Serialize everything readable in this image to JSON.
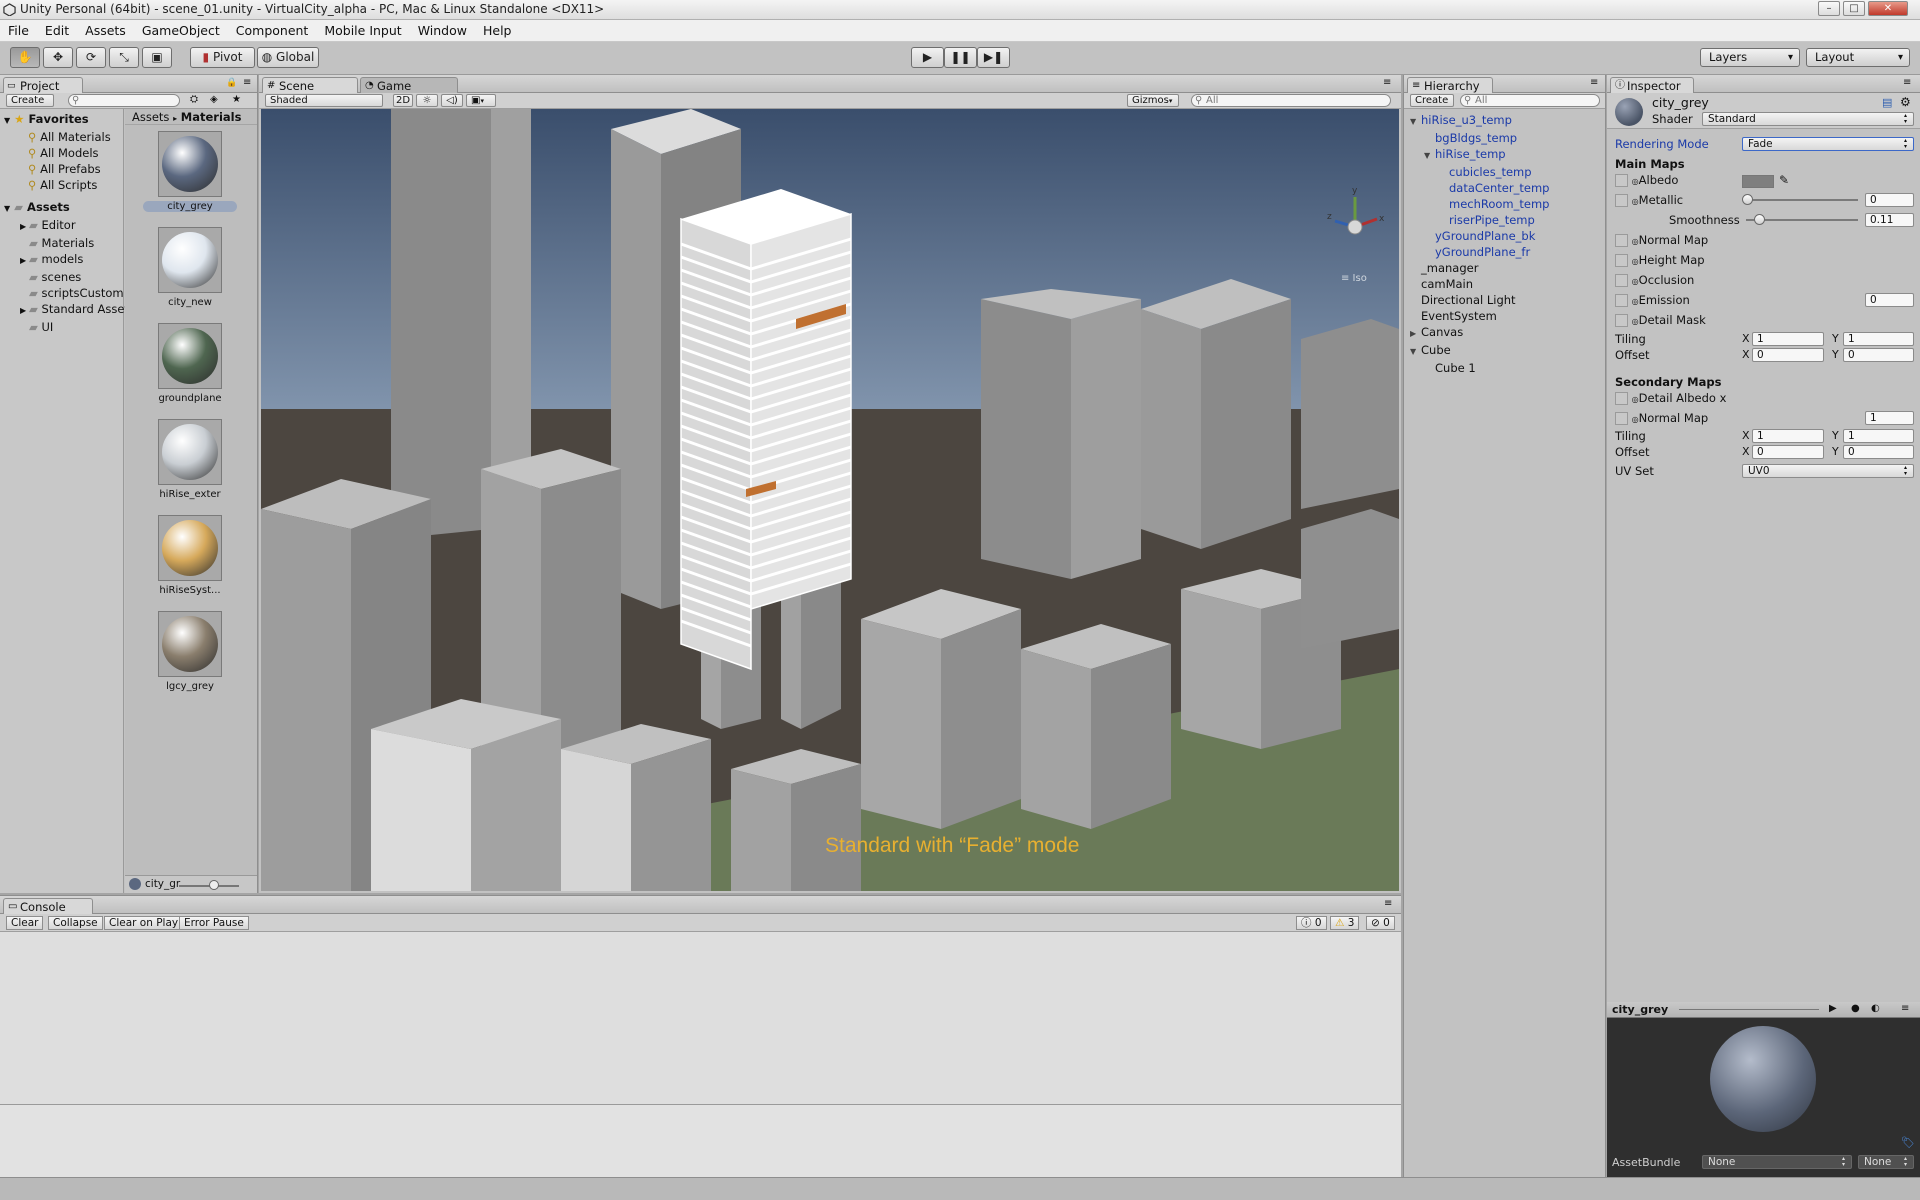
{
  "window": {
    "title": "Unity Personal (64bit) - scene_01.unity - VirtualCity_alpha - PC, Mac & Linux Standalone <DX11>",
    "minimize": "–",
    "maximize": "□",
    "close": "✕"
  },
  "menu": [
    "File",
    "Edit",
    "Assets",
    "GameObject",
    "Component",
    "Mobile Input",
    "Window",
    "Help"
  ],
  "toolbar": {
    "pivot": "Pivot",
    "global": "Global",
    "layers": "Layers",
    "layout": "Layout"
  },
  "project": {
    "tab": "Project",
    "create": "Create",
    "favorites_title": "Favorites",
    "favorites": [
      "All Materials",
      "All Models",
      "All Prefabs",
      "All Scripts"
    ],
    "assets_title": "Assets",
    "assets": [
      {
        "name": "Editor",
        "expandable": true
      },
      {
        "name": "Materials",
        "expandable": false
      },
      {
        "name": "models",
        "expandable": true
      },
      {
        "name": "scenes",
        "expandable": false
      },
      {
        "name": "scriptsCustom",
        "expandable": false
      },
      {
        "name": "Standard Assets",
        "expandable": true
      },
      {
        "name": "UI",
        "expandable": false
      }
    ],
    "breadcrumb": [
      "Assets",
      "Materials"
    ],
    "materials": [
      {
        "name": "city_grey",
        "selected": true,
        "color": "#5b6880"
      },
      {
        "name": "city_new",
        "selected": false,
        "color": "#dfe6ee"
      },
      {
        "name": "groundplane",
        "selected": false,
        "color": "#4f6650"
      },
      {
        "name": "hiRise_exter",
        "selected": false,
        "color": "#c9ced3"
      },
      {
        "name": "hiRiseSyst...",
        "selected": false,
        "color": "#d6a95b"
      },
      {
        "name": "lgcy_grey",
        "selected": false,
        "color": "#8a7e6d"
      }
    ],
    "footer_label": "city_gr"
  },
  "scene": {
    "tab_scene": "Scene",
    "tab_game": "Game",
    "shading": "Shaded",
    "mode_2d": "2D",
    "gizmos": "Gizmos",
    "search_placeholder": "All",
    "gizmo_label": "≡ Iso",
    "annotation": "Standard with “Fade” mode"
  },
  "hierarchy": {
    "tab": "Hierarchy",
    "create": "Create",
    "search_placeholder": "All",
    "items": [
      {
        "label": "hiRise_u3_temp",
        "depth": 0,
        "arrow": "▼",
        "blue": true
      },
      {
        "label": "bgBldgs_temp",
        "depth": 1,
        "arrow": "",
        "blue": true
      },
      {
        "label": "hiRise_temp",
        "depth": 1,
        "arrow": "▼",
        "blue": true
      },
      {
        "label": "cubicles_temp",
        "depth": 2,
        "arrow": "",
        "blue": true
      },
      {
        "label": "dataCenter_temp",
        "depth": 2,
        "arrow": "",
        "blue": true
      },
      {
        "label": "mechRoom_temp",
        "depth": 2,
        "arrow": "",
        "blue": true
      },
      {
        "label": "riserPipe_temp",
        "depth": 2,
        "arrow": "",
        "blue": true
      },
      {
        "label": "yGroundPlane_bk",
        "depth": 1,
        "arrow": "",
        "blue": true
      },
      {
        "label": "yGroundPlane_fr",
        "depth": 1,
        "arrow": "",
        "blue": true
      },
      {
        "label": "_manager",
        "depth": 0,
        "arrow": "",
        "blue": false
      },
      {
        "label": "camMain",
        "depth": 0,
        "arrow": "",
        "blue": false
      },
      {
        "label": "Directional Light",
        "depth": 0,
        "arrow": "",
        "blue": false
      },
      {
        "label": "EventSystem",
        "depth": 0,
        "arrow": "",
        "blue": false
      },
      {
        "label": "Canvas",
        "depth": 0,
        "arrow": "▶",
        "blue": false
      },
      {
        "label": "Cube",
        "depth": 0,
        "arrow": "▼",
        "blue": false
      },
      {
        "label": "Cube 1",
        "depth": 1,
        "arrow": "",
        "blue": false
      }
    ]
  },
  "inspector": {
    "tab": "Inspector",
    "material_name": "city_grey",
    "shader_label": "Shader",
    "shader_value": "Standard",
    "rendering_mode_label": "Rendering Mode",
    "rendering_mode_value": "Fade",
    "main_maps": "Main Maps",
    "albedo": "Albedo",
    "albedo_color": "#7f7f7f",
    "metallic": "Metallic",
    "metallic_value": "0",
    "metallic_level": 0.0,
    "smoothness": "Smoothness",
    "smoothness_value": "0.11",
    "smoothness_level": 0.11,
    "normal_map": "Normal Map",
    "height_map": "Height Map",
    "occlusion": "Occlusion",
    "emission": "Emission",
    "emission_value": "0",
    "detail_mask": "Detail Mask",
    "tiling": "Tiling",
    "offset": "Offset",
    "x": "X",
    "y": "Y",
    "tiling_x": "1",
    "tiling_y": "1",
    "offset_x": "0",
    "offset_y": "0",
    "secondary_maps": "Secondary Maps",
    "detail_albedo": "Detail Albedo x",
    "sec_normal_map": "Normal Map",
    "sec_normal_value": "1",
    "sec_tiling_x": "1",
    "sec_tiling_y": "1",
    "sec_offset_x": "0",
    "sec_offset_y": "0",
    "uv_set": "UV Set",
    "uv_set_value": "UV0",
    "preview_title": "city_grey",
    "assetbundle_label": "AssetBundle",
    "assetbundle_value": "None",
    "assetbundle_variant": "None"
  },
  "console": {
    "tab": "Console",
    "buttons": [
      "Clear",
      "Collapse",
      "Clear on Play",
      "Error Pause"
    ],
    "info_count": "0",
    "warn_count": "3",
    "error_count": "0"
  }
}
